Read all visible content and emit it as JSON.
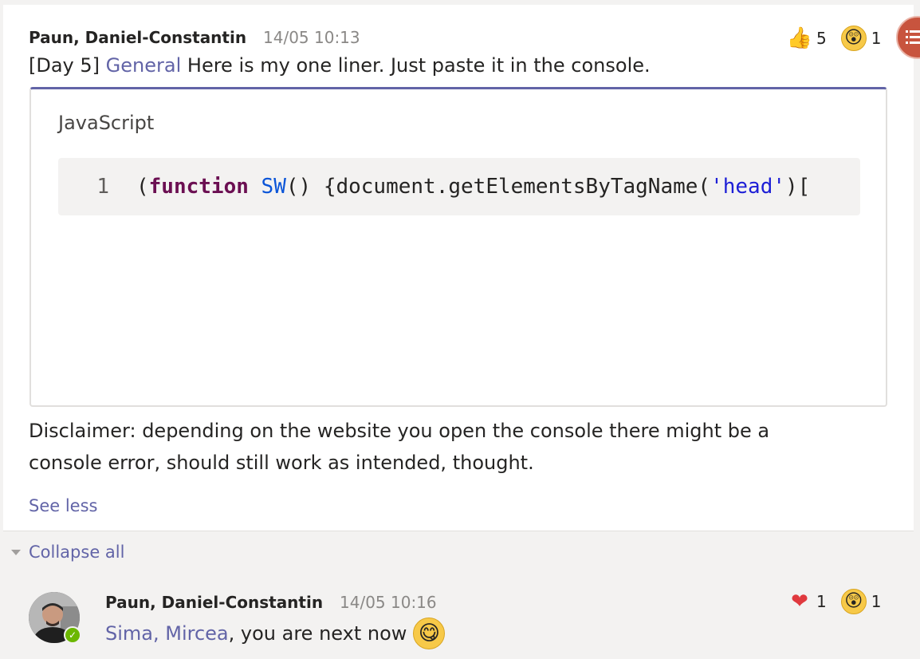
{
  "post": {
    "author": "Paun, Daniel-Constantin",
    "timestamp": "14/05 10:13",
    "reactions": [
      {
        "icon": "thumbs-up-icon",
        "count": "5"
      },
      {
        "icon": "surprised-icon",
        "count": "1"
      }
    ],
    "prefix": "[Day 5]",
    "channel_link": "General",
    "message": "Here is my one liner. Just paste it in the console.",
    "code_card": {
      "language": "JavaScript",
      "line_number": "1",
      "code_tokens": {
        "open": "(",
        "keyword": "function",
        "space": " ",
        "name": "SW",
        "mid": "() {document.getElementsByTagName(",
        "string": "'head'",
        "tail": ")["
      }
    },
    "disclaimer": "Disclaimer: depending on the website you open the console there might be a console error, should still work as intended, thought.",
    "see_less": "See less"
  },
  "thread": {
    "collapse_all": "Collapse all",
    "reply": {
      "author": "Paun, Daniel-Constantin",
      "timestamp": "14/05 10:16",
      "mention": "Sima, Mircea",
      "message": ", you are next now",
      "reactions": [
        {
          "icon": "heart-icon",
          "count": "1"
        },
        {
          "icon": "surprised-icon",
          "count": "1"
        }
      ]
    }
  },
  "colors": {
    "accent": "#6264a7",
    "presence_available": "#6bb700",
    "side_button": "#c8543e"
  }
}
